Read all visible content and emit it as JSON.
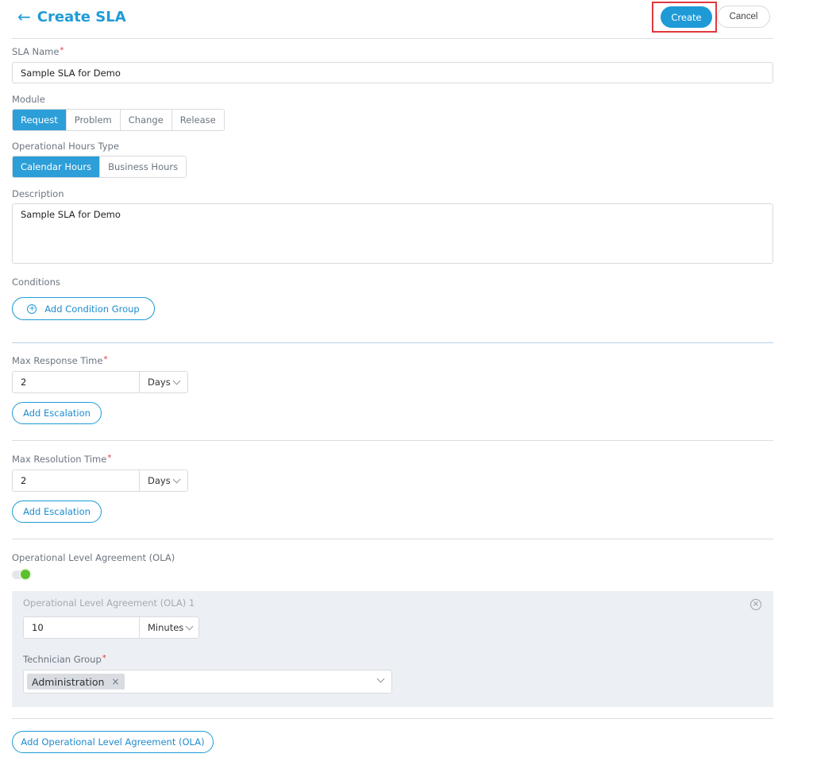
{
  "header": {
    "back_icon": "arrow-left-icon",
    "title": "Create SLA",
    "create_label": "Create",
    "cancel_label": "Cancel"
  },
  "sla_name": {
    "label": "SLA Name",
    "required_mark": "*",
    "value": "Sample SLA for Demo"
  },
  "module": {
    "label": "Module",
    "options": [
      "Request",
      "Problem",
      "Change",
      "Release"
    ],
    "selected": "Request"
  },
  "operational_hours": {
    "label": "Operational Hours Type",
    "options": [
      "Calendar Hours",
      "Business Hours"
    ],
    "selected": "Calendar Hours"
  },
  "description": {
    "label": "Description",
    "value": "Sample SLA for Demo"
  },
  "conditions": {
    "label": "Conditions",
    "add_group_label": "Add Condition Group"
  },
  "max_response": {
    "label": "Max Response Time",
    "required_mark": "*",
    "value": "2",
    "unit": "Days",
    "add_escalation_label": "Add Escalation"
  },
  "max_resolution": {
    "label": "Max Resolution Time",
    "required_mark": "*",
    "value": "2",
    "unit": "Days",
    "add_escalation_label": "Add Escalation"
  },
  "ola": {
    "label": "Operational Level Agreement (OLA)",
    "toggle_on": true,
    "items": [
      {
        "title": "Operational Level Agreement (OLA) 1",
        "value": "10",
        "unit": "Minutes",
        "technician_group_label": "Technician Group",
        "required_mark": "*",
        "technician_groups": [
          "Administration"
        ],
        "remove_tag_symbol": "×",
        "remove_icon_symbol": "×"
      }
    ],
    "add_label": "Add Operational Level Agreement (OLA)"
  },
  "colors": {
    "primary": "#1e9bd7",
    "highlight_border": "#e0393e",
    "toggle_on": "#5bbf2e",
    "ola_background": "#eceff3"
  }
}
